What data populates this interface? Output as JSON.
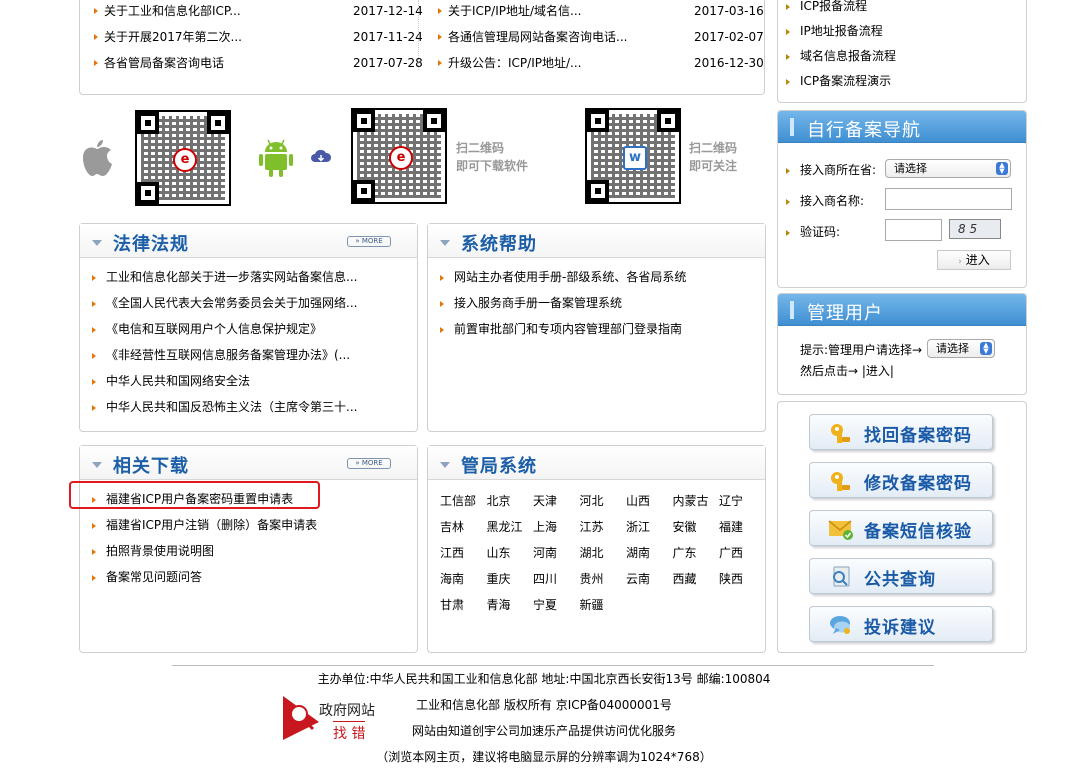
{
  "news": {
    "left": [
      {
        "title": "关于工业和信息化部ICP...",
        "date": "2017-12-14"
      },
      {
        "title": "关于开展2017年第二次...",
        "date": "2017-11-24"
      },
      {
        "title": "各省管局备案咨询电话",
        "date": "2017-07-28"
      }
    ],
    "right": [
      {
        "title": "关于ICP/IP地址/域名信...",
        "date": "2017-03-16"
      },
      {
        "title": "各通信管理局网站备案咨询电话...",
        "date": "2017-02-07"
      },
      {
        "title": "升级公告：ICP/IP地址/...",
        "date": "2016-12-30"
      }
    ]
  },
  "flow_links": [
    "ICP报备流程",
    "IP地址报备流程",
    "域名信息报备流程",
    "ICP备案流程演示"
  ],
  "qr": {
    "download_line1": "扫二维码",
    "download_line2": "即可下载软件",
    "follow_line1": "扫二维码",
    "follow_line2": "即可关注"
  },
  "laws": {
    "title": "法律法规",
    "more": "MORE",
    "items": [
      "工业和信息化部关于进一步落实网站备案信息...",
      "《全国人民代表大会常务委员会关于加强网络...",
      "《电信和互联网用户个人信息保护规定》",
      "《非经营性互联网信息服务备案管理办法》(...",
      "中华人民共和国网络安全法",
      "中华人民共和国反恐怖主义法（主席令第三十..."
    ]
  },
  "help": {
    "title": "系统帮助",
    "items": [
      "网站主办者使用手册-部级系统、各省局系统",
      "接入服务商手册一备案管理系统",
      "前置审批部门和专项内容管理部门登录指南"
    ]
  },
  "downloads": {
    "title": "相关下载",
    "more": "MORE",
    "items": [
      "福建省ICP用户备案密码重置申请表",
      "福建省ICP用户注销（删除）备案申请表",
      "拍照背景使用说明图",
      "备案常见问题问答"
    ]
  },
  "bureau": {
    "title": "管局系统",
    "cities": [
      "工信部",
      "北京",
      "天津",
      "河北",
      "山西",
      "内蒙古",
      "辽宁",
      "吉林",
      "黑龙江",
      "上海",
      "江苏",
      "浙江",
      "安徽",
      "福建",
      "江西",
      "山东",
      "河南",
      "湖北",
      "湖南",
      "广东",
      "广西",
      "海南",
      "重庆",
      "四川",
      "贵州",
      "云南",
      "西藏",
      "陕西",
      "甘肃",
      "青海",
      "宁夏",
      "新疆"
    ]
  },
  "self_nav": {
    "title": "自行备案导航",
    "isp_label": "接入商所在省:",
    "isp_select": "请选择",
    "name_label": "接入商名称:",
    "captcha_label": "验证码:",
    "captcha_text": "8 5",
    "enter": "进入"
  },
  "manage": {
    "title": "管理用户",
    "hint_prefix": "提示:管理用户请选择→",
    "select": "请选择",
    "hint_suffix": "然后点击→ |进入|"
  },
  "actions": [
    {
      "label": "找回备案密码",
      "icon": "key-icon"
    },
    {
      "label": "修改备案密码",
      "icon": "key-icon"
    },
    {
      "label": "备案短信核验",
      "icon": "sms-icon"
    },
    {
      "label": "公共查询",
      "icon": "query-icon"
    },
    {
      "label": "投诉建议",
      "icon": "chat-icon"
    }
  ],
  "footer": {
    "line1": "主办单位:中华人民共和国工业和信息化部 地址:中国北京西长安街13号 邮编:100804",
    "line2": "工业和信息化部 版权所有 京ICP备04000001号",
    "line3": "网站由知道创宇公司加速乐产品提供访问优化服务",
    "line4": "（浏览本网主页，建议将电脑显示屏的分辨率调为1024*768）",
    "gov_logo_top": "政府网站",
    "gov_logo_bottom": "找 错"
  },
  "colors": {
    "accent": "#1c5fa8",
    "arrow": "#e8740c",
    "highlight": "#e0191e",
    "blue_head": "#4b9ad8"
  }
}
